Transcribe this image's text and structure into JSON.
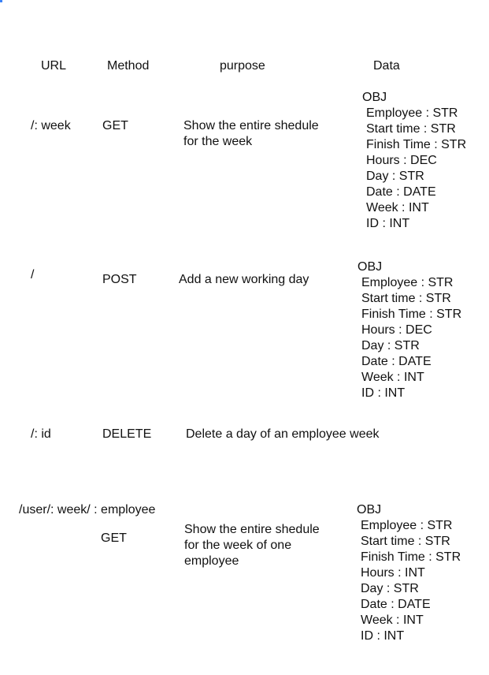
{
  "headers": {
    "url": "URL",
    "method": "Method",
    "purpose": "purpose",
    "data": "Data"
  },
  "routes": [
    {
      "url": "/: week",
      "method": "GET",
      "purpose_lines": [
        "Show the entire shedule",
        "for the week"
      ],
      "data": {
        "type": "OBJ",
        "fields": [
          "Employee : STR",
          "Start time : STR",
          "Finish Time  : STR",
          "Hours : DEC",
          "Day : STR",
          "Date : DATE",
          "Week : INT",
          "ID : INT"
        ]
      }
    },
    {
      "url": "/",
      "method": "POST",
      "purpose_lines": [
        "Add a new working day"
      ],
      "data": {
        "type": "OBJ",
        "fields": [
          "Employee : STR",
          "Start time : STR",
          "Finish Time  : STR",
          "Hours : DEC",
          "Day : STR",
          "Date : DATE",
          "Week : INT",
          "ID : INT"
        ]
      }
    },
    {
      "url": "/: id",
      "method": "DELETE",
      "purpose_lines": [
        "Delete a day of an employee week"
      ]
    },
    {
      "url": "/user/: week/ : employee",
      "method": "GET",
      "purpose_lines": [
        "Show the entire shedule",
        "for the week of one",
        "employee"
      ],
      "data": {
        "type": "OBJ",
        "fields": [
          "Employee : STR",
          "Start time : STR",
          "Finish Time  : STR",
          "Hours : INT",
          "Day : STR",
          "Date : DATE",
          "Week : INT",
          "ID : INT"
        ]
      }
    }
  ]
}
